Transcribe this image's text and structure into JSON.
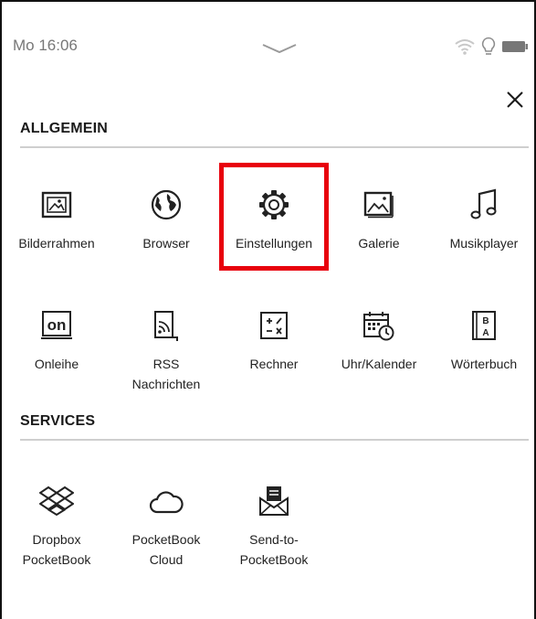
{
  "status_bar": {
    "time": "Mo 16:06",
    "icons": [
      "wifi-icon",
      "light-bulb-icon",
      "battery-icon"
    ]
  },
  "header": {
    "pull_down_icon": "chevron-down-icon",
    "close_icon": "close-icon"
  },
  "sections": {
    "allgemein": {
      "title": "ALLGEMEIN",
      "apps": [
        {
          "label": "Bilderrahmen",
          "icon": "picture-frame-icon"
        },
        {
          "label": "Browser",
          "icon": "globe-icon"
        },
        {
          "label": "Einstellungen",
          "icon": "gear-icon"
        },
        {
          "label": "Galerie",
          "icon": "gallery-icon"
        },
        {
          "label": "Musikplayer",
          "icon": "music-note-icon"
        },
        {
          "label": "Onleihe",
          "icon": "onleihe-icon"
        },
        {
          "label": "RSS",
          "label2": "Nachrichten",
          "icon": "rss-icon"
        },
        {
          "label": "Rechner",
          "icon": "calculator-icon"
        },
        {
          "label": "Uhr/Kalender",
          "icon": "calendar-clock-icon"
        },
        {
          "label": "Wörterbuch",
          "icon": "dictionary-icon"
        }
      ]
    },
    "services": {
      "title": "SERVICES",
      "apps": [
        {
          "label": "Dropbox",
          "label2": "PocketBook",
          "icon": "dropbox-icon"
        },
        {
          "label": "PocketBook",
          "label2": "Cloud",
          "icon": "cloud-icon"
        },
        {
          "label": "Send-to-",
          "label2": "PocketBook",
          "icon": "mail-envelope-icon"
        }
      ]
    }
  },
  "highlight": {
    "target": "Einstellungen",
    "color": "#e8000c"
  }
}
